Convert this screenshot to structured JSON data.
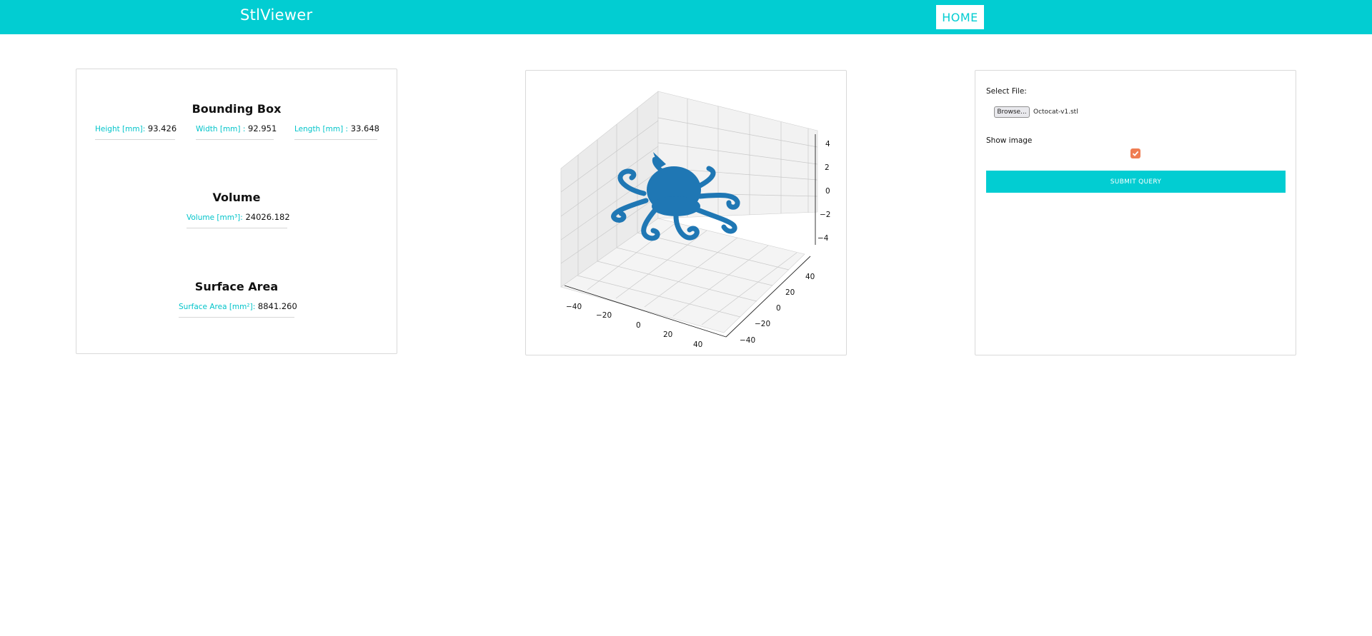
{
  "navbar": {
    "brand": "StlViewer",
    "home_label": "HOME"
  },
  "bounding_box": {
    "title": "Bounding Box",
    "height_label": "Height [mm]:",
    "height_value": "93.426",
    "width_label": "Width [mm] :",
    "width_value": "92.951",
    "length_label": "Length [mm] :",
    "length_value": "33.648"
  },
  "volume": {
    "title": "Volume",
    "label": "Volume [mm³]:",
    "value": "24026.182"
  },
  "surface_area": {
    "title": "Surface Area",
    "label": "Surface Area [mm²]:",
    "value": "8841.260"
  },
  "plot": {
    "x_ticks": [
      "−40",
      "−20",
      "0",
      "20",
      "40"
    ],
    "y_ticks": [
      "−40",
      "−20",
      "0",
      "20",
      "40"
    ],
    "z_ticks": [
      "4",
      "2",
      "0",
      "−2",
      "−4"
    ],
    "mesh_color": "#1f77b4"
  },
  "form": {
    "select_file_label": "Select File:",
    "browse_label": "Browse...",
    "file_name": "Octocat-v1.stl",
    "show_image_label": "Show image",
    "show_image_checked": true,
    "submit_label": "SUBMIT QUERY"
  },
  "colors": {
    "accent": "#02cdd2",
    "checkbox": "#ef7d52"
  }
}
